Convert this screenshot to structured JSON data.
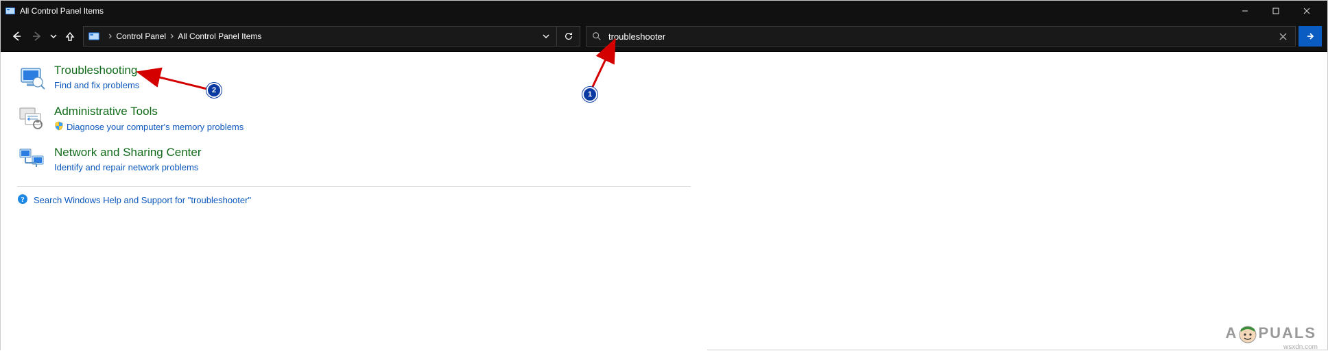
{
  "window": {
    "title": "All Control Panel Items",
    "minimize": "—",
    "maximize": "▢",
    "close": "✕"
  },
  "navigation": {
    "crumbs": [
      "Control Panel",
      "All Control Panel Items"
    ],
    "dropdown": "▾"
  },
  "search": {
    "value": "troubleshooter",
    "clear": "✕",
    "go": "→"
  },
  "categories": [
    {
      "title": "Troubleshooting",
      "subtitle": "Find and fix problems",
      "shield": false
    },
    {
      "title": "Administrative Tools",
      "subtitle": "Diagnose your computer's memory problems",
      "shield": true
    },
    {
      "title": "Network and Sharing Center",
      "subtitle": "Identify and repair network problems",
      "shield": false
    }
  ],
  "help_link": "Search Windows Help and Support for \"troubleshooter\"",
  "badges": {
    "one": "1",
    "two": "2"
  },
  "watermark": {
    "part1": "A",
    "part2": "PUALS"
  },
  "footer_src": "wsxdn.com"
}
